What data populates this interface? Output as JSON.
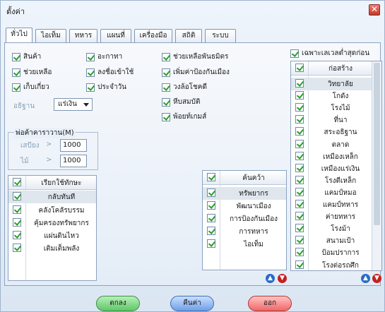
{
  "window": {
    "title": "ตั้งค่า"
  },
  "tabs": [
    "ทั่วไป",
    "ไอเท็ม",
    "ทหาร",
    "แผนที่",
    "เครื่องมือ",
    "สถิติ",
    "ระบบ"
  ],
  "general": {
    "col1": [
      "สินค้า",
      "ช่วยเหลือ",
      "เก็บเกี่ยว"
    ],
    "col2": [
      "อะกาทา",
      "ลงชื่อเข้าใช้",
      "ประจำวัน"
    ],
    "col3": [
      "ช่วยเหลือพันธมิตร",
      "เพิ่มค่าป้องกันเมือง",
      "วงล้อโชคดี",
      "หีบสมบัติ",
      "พ้อยท์เกมส์"
    ],
    "basis_label": "อธิฐาน",
    "basis_value": "แร่เงิน"
  },
  "merchant": {
    "title": "พ่อค้าคาราวาน(M)",
    "rows": [
      {
        "label": "เสบียง",
        "op": ">",
        "value": "1000"
      },
      {
        "label": "ไม้",
        "op": ">",
        "value": "1000"
      }
    ]
  },
  "skills_list": {
    "header": "เรียกใช้ทักษะ",
    "items": [
      "กลับทันที",
      "คลังโคลัรบรรม",
      "คุ้มครองทรัพยากร",
      "แผ่นดินไหว",
      "เติมเต็มพลัง"
    ]
  },
  "research_list": {
    "header": "ค้นคว้า",
    "items": [
      "ทรัพยากร",
      "พัฒนาเมือง",
      "การป้องกันเมือง",
      "การทหาร",
      "ไอเท็ม"
    ]
  },
  "build": {
    "only_lowest_label": "เฉพาะเลเวลต่ำสุดก่อน",
    "header": "ก่อสร้าง",
    "items": [
      "วิทยาลัย",
      "โกดัง",
      "โรงไม้",
      "ที่นา",
      "สระอธิฐาน",
      "ตลาด",
      "เหมืองเหล็ก",
      "เหมืองแร่เงิน",
      "โรงตีเหล็ก",
      "แคมป์หมอ",
      "แคมป์ทหาร",
      "ค่ายทหาร",
      "โรงม้า",
      "สนามเป้า",
      "ป้อมปราการ",
      "โรงต่อรถศึก"
    ]
  },
  "buttons": {
    "ok": "ตกลง",
    "default": "คืนค่า",
    "exit": "ออก"
  }
}
